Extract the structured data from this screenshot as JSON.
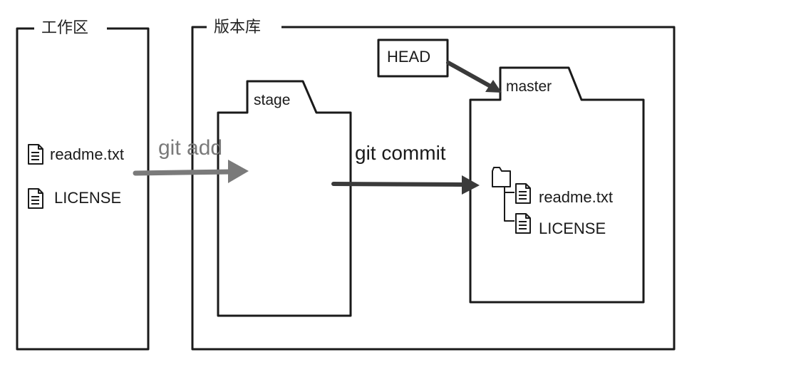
{
  "workspace": {
    "title": "工作区",
    "files": [
      "readme.txt",
      "LICENSE"
    ]
  },
  "repository": {
    "title": "版本库",
    "stage_label": "stage",
    "master_label": "master",
    "head_label": "HEAD",
    "tree_files": [
      "readme.txt",
      "LICENSE"
    ]
  },
  "arrows": {
    "add_label": "git add",
    "commit_label": "git commit"
  },
  "colors": {
    "ink": "#1a1a1a",
    "add_arrow": "#7a7a7a",
    "commit_arrow": "#3a3a3a",
    "head_arrow": "#3a3a3a"
  }
}
